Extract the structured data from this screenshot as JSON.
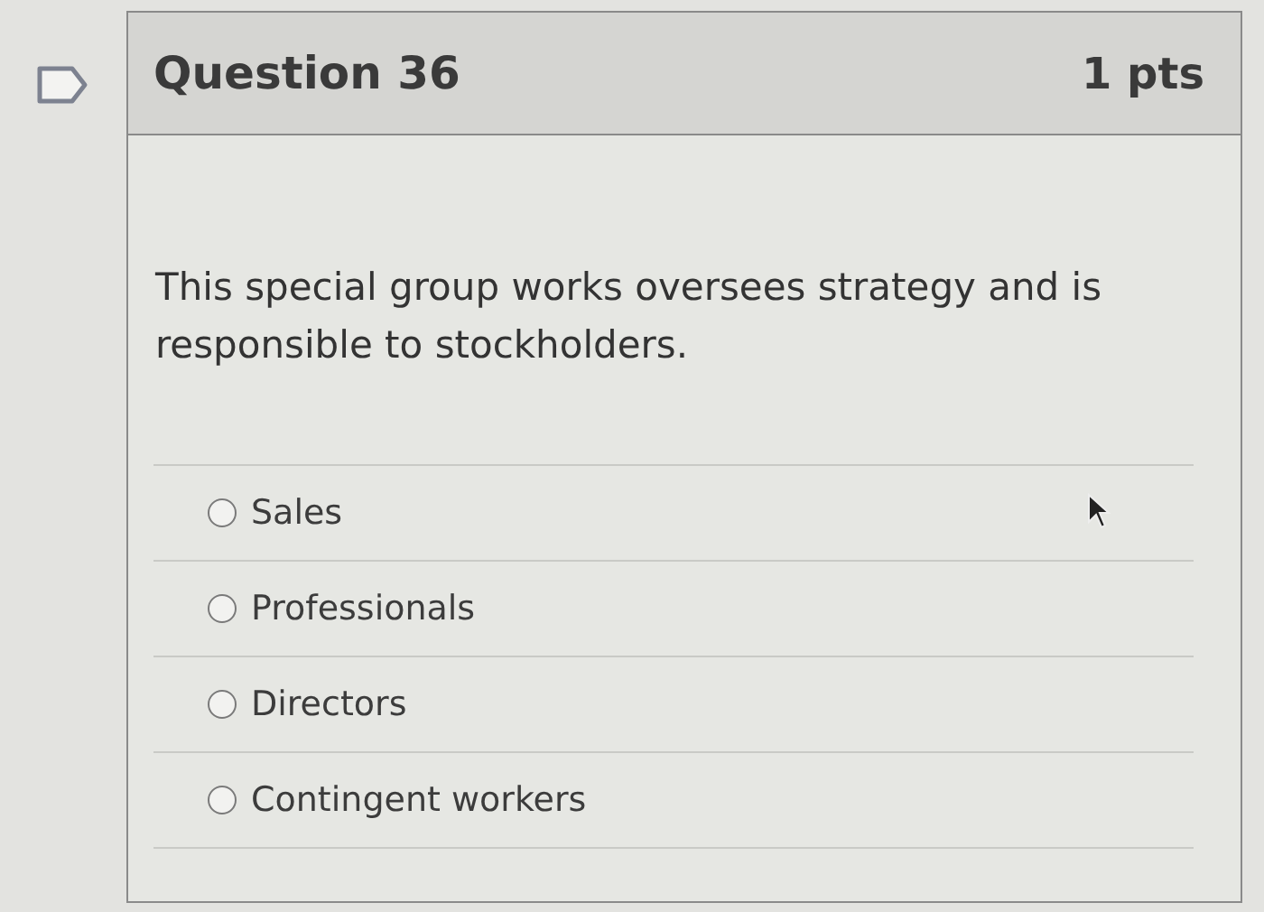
{
  "question": {
    "title": "Question 36",
    "points": "1 pts",
    "flagged": false,
    "text": "This special group works oversees strategy and is responsible to stockholders.",
    "answers": [
      {
        "label": "Sales",
        "selected": false
      },
      {
        "label": "Professionals",
        "selected": false
      },
      {
        "label": "Directors",
        "selected": false
      },
      {
        "label": "Contingent workers",
        "selected": false
      }
    ]
  }
}
